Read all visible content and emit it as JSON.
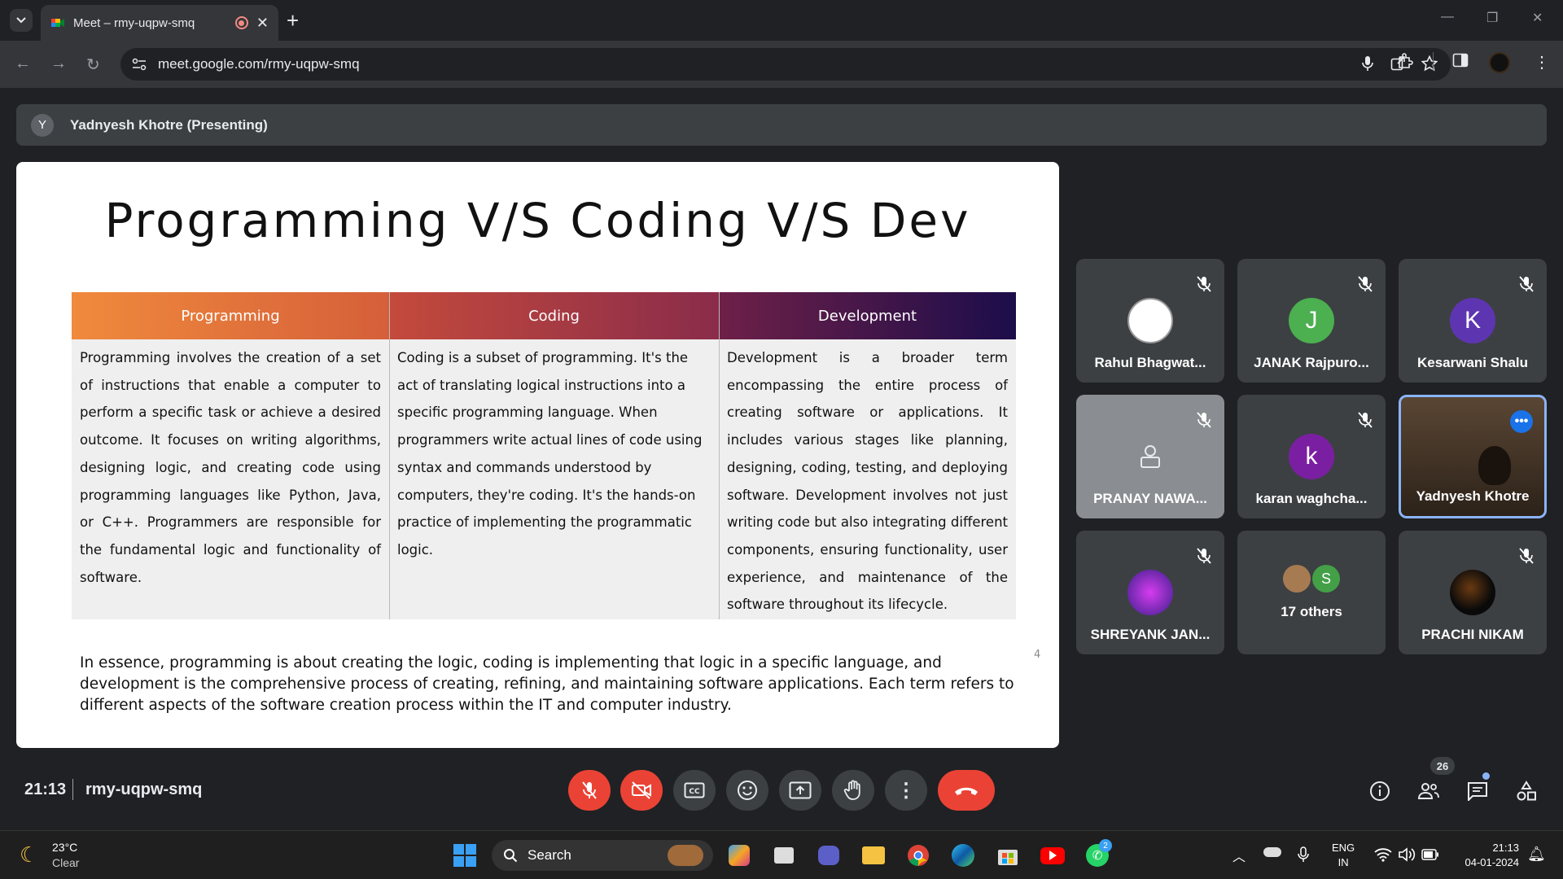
{
  "browser": {
    "tab_title": "Meet – rmy-uqpw-smq",
    "url": "meet.google.com/rmy-uqpw-smq"
  },
  "presenter": {
    "initial": "Y",
    "label": "Yadnyesh Khotre (Presenting)"
  },
  "slide": {
    "title": "Programming V/S Coding V/S Dev",
    "columns": [
      "Programming",
      "Coding",
      "Development"
    ],
    "cells": [
      "Programming involves the creation of a set of instructions that enable a computer to perform a specific task or achieve a desired outcome. It focuses on writing algorithms, designing logic, and creating code using programming languages like Python, Java, or C++. Programmers are responsible for the fundamental logic and functionality of software.",
      "Coding is a subset of programming. It's the act of translating logical instructions into a specific programming language. When programmers write actual lines of code using syntax and commands understood by computers, they're coding. It's the hands-on practice of implementing the programmatic logic.",
      "Development is a broader term encompassing the entire process of creating software or applications. It includes various stages like planning, designing, coding, testing, and deploying software. Development involves not just writing code but also integrating different components, ensuring functionality, user experience, and maintenance of the software throughout its lifecycle."
    ],
    "summary": "In essence, programming is about creating the logic, coding is implementing that logic in a specific language, and development is the comprehensive process of creating, refining, and maintaining software applications. Each term refers to different aspects of the software creation process within the IT and computer industry.",
    "page_number": "4"
  },
  "participants": [
    {
      "name": "Rahul Bhagwat...",
      "initial": "",
      "color": "#ffffff"
    },
    {
      "name": "JANAK Rajpuro...",
      "initial": "J",
      "color": "#4caf50"
    },
    {
      "name": "Kesarwani Shalu",
      "initial": "K",
      "color": "#5e35b1"
    },
    {
      "name": "PRANAY NAWA...",
      "initial": "",
      "color": "#80868b"
    },
    {
      "name": "karan waghcha...",
      "initial": "k",
      "color": "#7b1fa2"
    },
    {
      "name": "Yadnyesh Khotre",
      "initial": "",
      "color": "#3a2c20"
    },
    {
      "name": "SHREYANK JAN...",
      "initial": "",
      "color": "#3a1f8a"
    },
    {
      "name": "17 others",
      "initial": "S",
      "color": "#43a047"
    },
    {
      "name": "PRACHI NIKAM",
      "initial": "",
      "color": "#111111"
    }
  ],
  "meeting": {
    "time": "21:13",
    "code": "rmy-uqpw-smq",
    "people_count": "26"
  },
  "taskbar": {
    "weather_temp": "23°C",
    "weather_desc": "Clear",
    "search_label": "Search",
    "lang_top": "ENG",
    "lang_bottom": "IN",
    "clock_time": "21:13",
    "clock_date": "04-01-2024",
    "chrome_badge": "",
    "whatsapp_badge": "2"
  }
}
